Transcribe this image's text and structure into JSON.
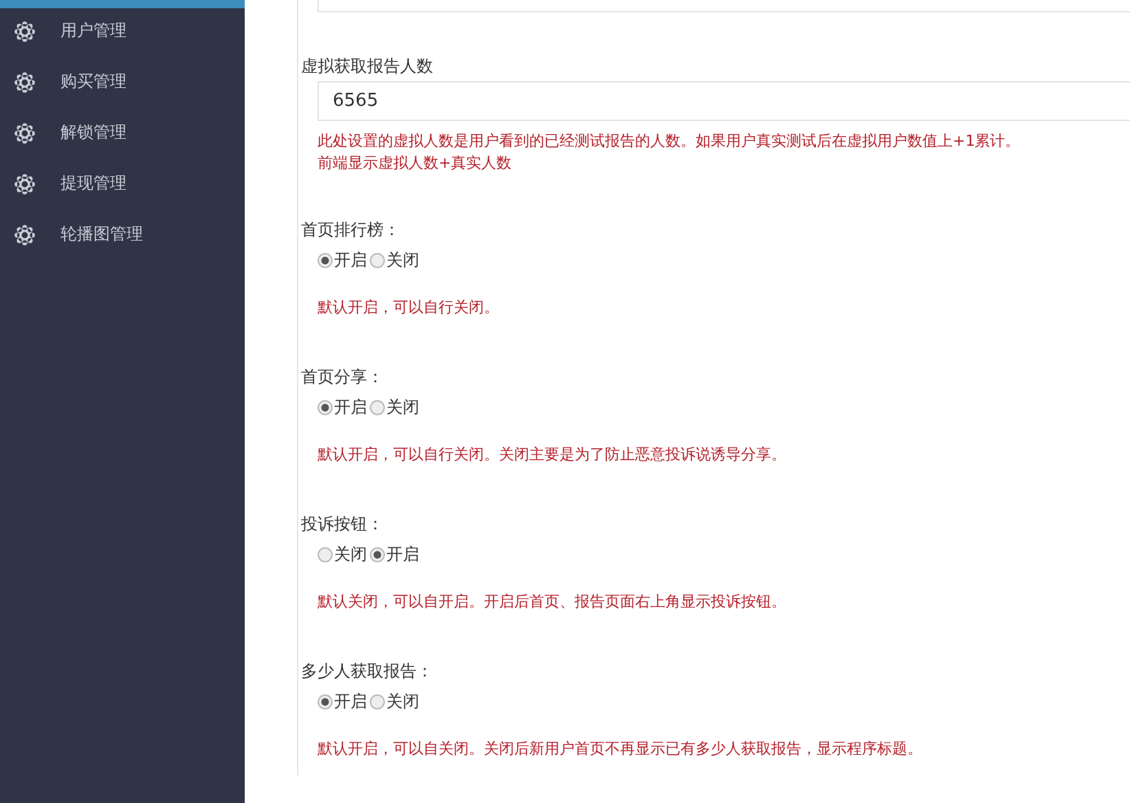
{
  "sidebar": {
    "items": [
      {
        "label": "用户管理"
      },
      {
        "label": "购买管理"
      },
      {
        "label": "解锁管理"
      },
      {
        "label": "提现管理"
      },
      {
        "label": "轮播图管理"
      }
    ]
  },
  "settings": [
    {
      "kind": "text",
      "label": "虚拟获取报告人数",
      "value": "6565",
      "help": [
        "此处设置的虚拟人数是用户看到的已经测试报告的人数。如果用户真实测试后在虚拟用户数值上+1累计。",
        "前端显示虚拟人数+真实人数"
      ]
    },
    {
      "kind": "radio",
      "label": "首页排行榜：",
      "options": [
        {
          "label": "开启",
          "selected": true
        },
        {
          "label": "关闭",
          "selected": false
        }
      ],
      "help": "默认开启，可以自行关闭。"
    },
    {
      "kind": "radio",
      "label": "首页分享：",
      "options": [
        {
          "label": "开启",
          "selected": true
        },
        {
          "label": "关闭",
          "selected": false
        }
      ],
      "help": "默认开启，可以自行关闭。关闭主要是为了防止恶意投诉说诱导分享。"
    },
    {
      "kind": "radio",
      "label": "投诉按钮：",
      "options": [
        {
          "label": "关闭",
          "selected": false
        },
        {
          "label": "开启",
          "selected": true
        }
      ],
      "help": "默认关闭，可以自开启。开启后首页、报告页面右上角显示投诉按钮。"
    },
    {
      "kind": "radio",
      "label": "多少人获取报告：",
      "options": [
        {
          "label": "开启",
          "selected": true
        },
        {
          "label": "关闭",
          "selected": false
        }
      ],
      "help": "默认开启，可以自关闭。关闭后新用户首页不再显示已有多少人获取报告，显示程序标题。"
    }
  ]
}
